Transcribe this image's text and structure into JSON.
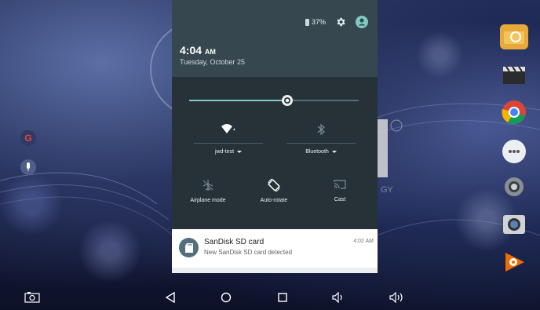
{
  "status": {
    "battery_percent": "37%",
    "icons": [
      "battery-icon",
      "settings-icon",
      "user-icon"
    ]
  },
  "header": {
    "time": "4:04",
    "ampm": "AM",
    "date": "Tuesday, October 25"
  },
  "brightness": {
    "level": 0.58
  },
  "quick_settings": {
    "wifi": {
      "label": "jwd-test",
      "icon": "wifi-icon",
      "state": "on"
    },
    "bluetooth": {
      "label": "Bluetooth",
      "icon": "bluetooth-icon",
      "state": "off"
    },
    "airplane": {
      "label": "Airplane mode",
      "icon": "airplane-icon",
      "state": "off"
    },
    "rotate": {
      "label": "Auto-rotate",
      "icon": "auto-rotate-icon",
      "state": "on"
    },
    "cast": {
      "label": "Cast",
      "icon": "cast-icon",
      "state": "off"
    }
  },
  "notification": {
    "title": "SanDisk SD card",
    "text": "New SanDisk SD card detected",
    "time": "4:02 AM",
    "icon": "sd-card-icon"
  },
  "navbar": {
    "icons": [
      "screenshot-icon",
      "back-icon",
      "home-icon",
      "recents-icon",
      "volume-down-icon",
      "volume-up-icon"
    ]
  },
  "colors": {
    "accent": "#80cbc4",
    "shade_bg": "#263238",
    "shade_header": "#37474f"
  }
}
